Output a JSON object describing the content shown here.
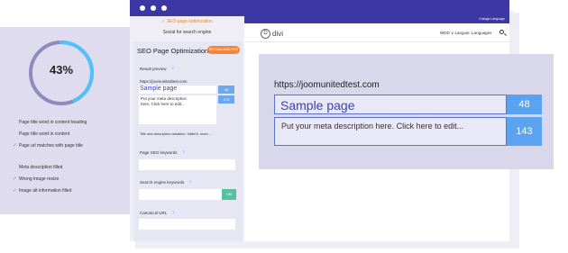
{
  "score": {
    "percent_label": "43%",
    "percent_value": 43,
    "ring_color": "#4fc3f7",
    "track_color": "#8e8bbf",
    "items": [
      {
        "label": "Page title word in content heading",
        "checked": false
      },
      {
        "label": "Page title word in content",
        "checked": false
      },
      {
        "label": "Page url matches with page title",
        "checked": true
      },
      {
        "label": "Meta description filled",
        "checked": false
      },
      {
        "label": "Wrong image resize",
        "checked": true
      },
      {
        "label": "Image alt information filled",
        "checked": true
      }
    ]
  },
  "window": {
    "titlebar_color": "#3d37a6",
    "accent_orange": "#f2843b"
  },
  "seo_panel": {
    "tab_active": "✓ SEO page optimization",
    "tab_second": "Social for search engine",
    "title": "SEO Page Optimization",
    "reload_button": "RELOAD ANALYSIS",
    "result_preview_label": "Result preview",
    "mini_url": "https://joomunitedtest.com",
    "mini_title": "Sample page",
    "mini_title_count": "48",
    "mini_desc": "Put your meta description here, Click here to edit...",
    "mini_desc_count": "174",
    "variables_note": "Title and description variables: %title%, more...",
    "keywords_label": "Page SEO keywords",
    "engine_keywords_label": "Search engine keywords",
    "engine_keywords_count": "186",
    "canonical_label": "Canonical URL",
    "help_icon": "?"
  },
  "site": {
    "lang_bar_text": "Change Language",
    "logo_text": "divi",
    "logo_letter": "D",
    "nav_text": "WDD ∨  Languie: Languages"
  },
  "preview": {
    "url": "https://joomunitedtest.com",
    "title": "Sample page",
    "title_count": "48",
    "description": "Put your meta description here. Click here to edit...",
    "description_count": "143"
  }
}
